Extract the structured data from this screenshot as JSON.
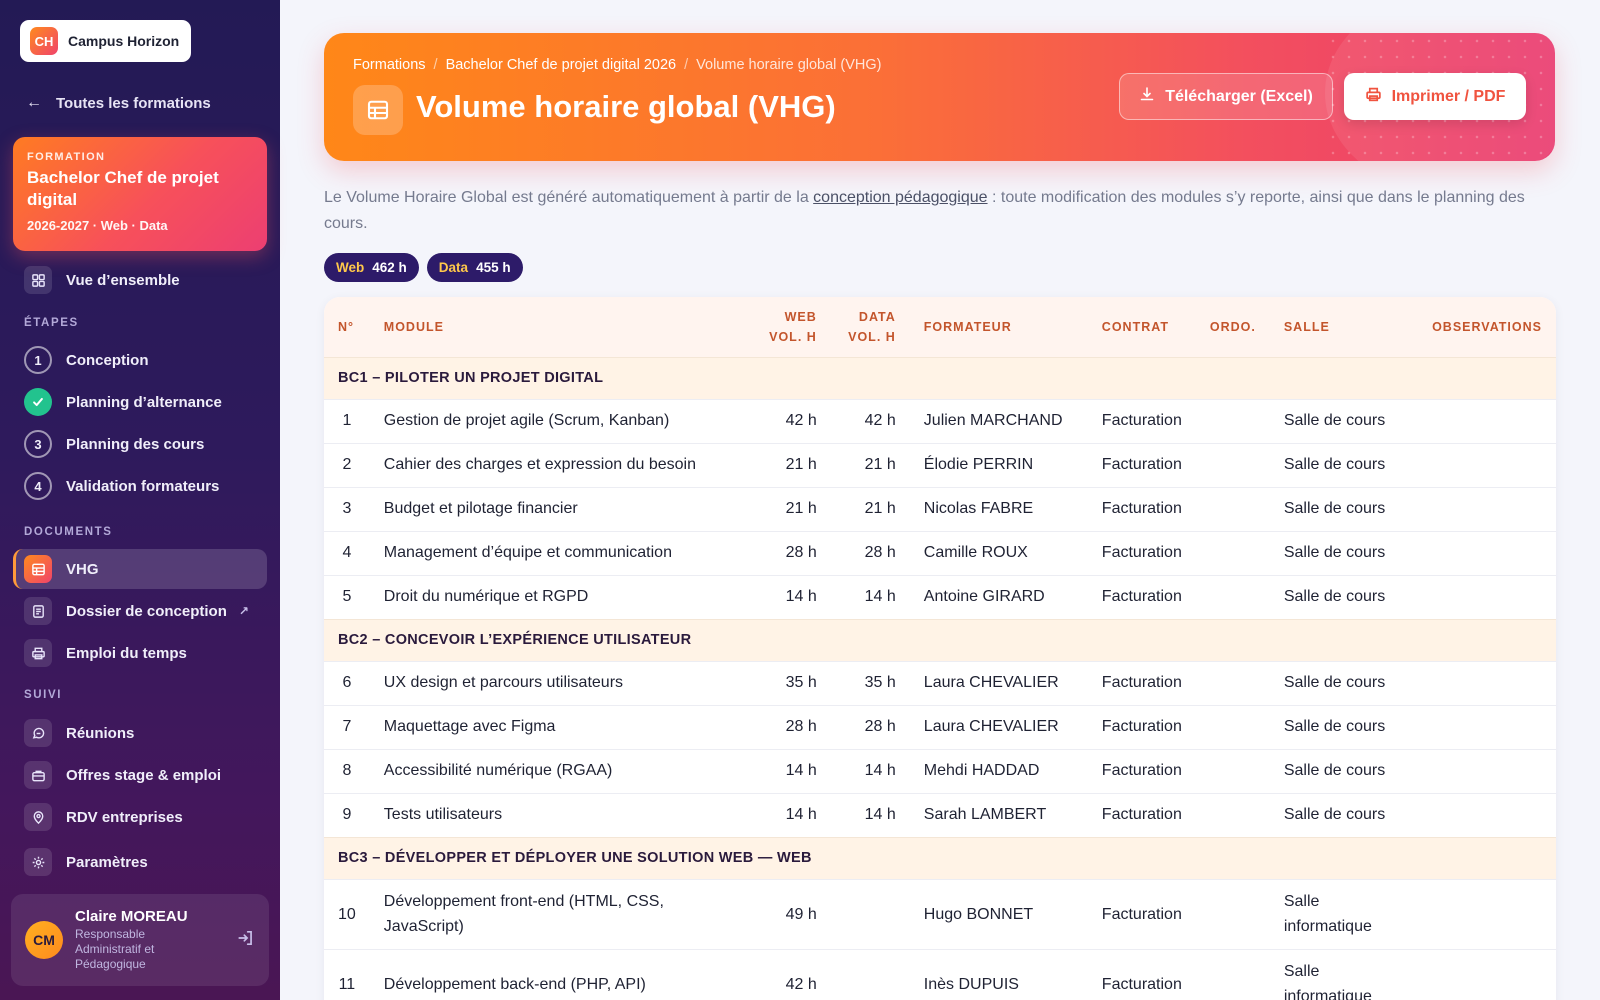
{
  "brand": {
    "initials": "CH",
    "name": "Campus Horizon"
  },
  "back_link": "Toutes les formations",
  "formation": {
    "label": "FORMATION",
    "title": "Bachelor Chef de projet digital",
    "meta": "2026-2027 · Web · Data"
  },
  "nav": {
    "overview": "Vue d’ensemble",
    "steps_label": "ÉTAPES",
    "steps": [
      {
        "num": "1",
        "label": "Conception"
      },
      {
        "num": "",
        "label": "Planning d’alternance"
      },
      {
        "num": "3",
        "label": "Planning des cours"
      },
      {
        "num": "4",
        "label": "Validation formateurs"
      }
    ],
    "documents_label": "DOCUMENTS",
    "documents": [
      {
        "label": "VHG"
      },
      {
        "label": "Dossier de conception",
        "ext": "↗"
      },
      {
        "label": "Emploi du temps"
      }
    ],
    "suivi_label": "SUIVI",
    "suivi": [
      {
        "label": "Réunions"
      },
      {
        "label": "Offres stage & emploi"
      },
      {
        "label": "RDV entreprises"
      },
      {
        "label": "Paramètres"
      }
    ]
  },
  "user": {
    "initials": "CM",
    "name": "Claire MOREAU",
    "role": "Responsable Administratif et Pédagogique"
  },
  "header": {
    "breadcrumb": [
      "Formations",
      "Bachelor Chef de projet digital 2026",
      "Volume horaire global (VHG)"
    ],
    "breadcrumb_sep": "/",
    "title": "Volume horaire global (VHG)",
    "btn_excel": "Télécharger (Excel)",
    "btn_pdf": "Imprimer / PDF"
  },
  "intro": {
    "before": "Le Volume Horaire Global est généré automatiquement à partir de la ",
    "link": "conception pédagogique",
    "after": " : toute modification des modules s’y reporte, ainsi que dans le planning des cours."
  },
  "totals": [
    {
      "key": "Web",
      "value": "462 h"
    },
    {
      "key": "Data",
      "value": "455 h"
    }
  ],
  "table": {
    "headers": {
      "num": "N°",
      "module": "MODULE",
      "web_1": "WEB",
      "web_2": "VOL. H",
      "data_1": "DATA",
      "data_2": "VOL. H",
      "formateur": "FORMATEUR",
      "contrat": "CONTRAT",
      "ordo": "ORDO.",
      "salle": "SALLE",
      "observations": "OBSERVATIONS"
    },
    "groups": [
      {
        "title": "BC1 – PILOTER UN PROJET DIGITAL",
        "rows": [
          {
            "n": "1",
            "module": "Gestion de projet agile (Scrum, Kanban)",
            "web": "42 h",
            "data": "42 h",
            "formateur": "Julien MARCHAND",
            "contrat": "Facturation",
            "salle": "Salle de cours"
          },
          {
            "n": "2",
            "module": "Cahier des charges et expression du besoin",
            "web": "21 h",
            "data": "21 h",
            "formateur": "Élodie PERRIN",
            "contrat": "Facturation",
            "salle": "Salle de cours"
          },
          {
            "n": "3",
            "module": "Budget et pilotage financier",
            "web": "21 h",
            "data": "21 h",
            "formateur": "Nicolas FABRE",
            "contrat": "Facturation",
            "salle": "Salle de cours"
          },
          {
            "n": "4",
            "module": "Management d’équipe et communication",
            "web": "28 h",
            "data": "28 h",
            "formateur": "Camille ROUX",
            "contrat": "Facturation",
            "salle": "Salle de cours"
          },
          {
            "n": "5",
            "module": "Droit du numérique et RGPD",
            "web": "14 h",
            "data": "14 h",
            "formateur": "Antoine GIRARD",
            "contrat": "Facturation",
            "salle": "Salle de cours"
          }
        ]
      },
      {
        "title": "BC2 – CONCEVOIR L’EXPÉRIENCE UTILISATEUR",
        "rows": [
          {
            "n": "6",
            "module": "UX design et parcours utilisateurs",
            "web": "35 h",
            "data": "35 h",
            "formateur": "Laura CHEVALIER",
            "contrat": "Facturation",
            "salle": "Salle de cours"
          },
          {
            "n": "7",
            "module": "Maquettage avec Figma",
            "web": "28 h",
            "data": "28 h",
            "formateur": "Laura CHEVALIER",
            "contrat": "Facturation",
            "salle": "Salle de cours"
          },
          {
            "n": "8",
            "module": "Accessibilité numérique (RGAA)",
            "web": "14 h",
            "data": "14 h",
            "formateur": "Mehdi HADDAD",
            "contrat": "Facturation",
            "salle": "Salle de cours"
          },
          {
            "n": "9",
            "module": "Tests utilisateurs",
            "web": "14 h",
            "data": "14 h",
            "formateur": "Sarah LAMBERT",
            "contrat": "Facturation",
            "salle": "Salle de cours"
          }
        ]
      },
      {
        "title": "BC3 – DÉVELOPPER ET DÉPLOYER UNE SOLUTION WEB — WEB",
        "rows": [
          {
            "n": "10",
            "module": "Développement front-end (HTML, CSS, JavaScript)",
            "web": "49 h",
            "data": "",
            "formateur": "Hugo BONNET",
            "contrat": "Facturation",
            "salle": "Salle informatique"
          },
          {
            "n": "11",
            "module": "Développement back-end (PHP, API)",
            "web": "42 h",
            "data": "",
            "formateur": "Inès DUPUIS",
            "contrat": "Facturation",
            "salle": "Salle informatique"
          }
        ]
      }
    ]
  },
  "colors": {
    "accent_orange": "#ff8718",
    "accent_pink": "#ea3c70",
    "sidebar_navy": "#231a55",
    "success_green": "#22c38e"
  }
}
